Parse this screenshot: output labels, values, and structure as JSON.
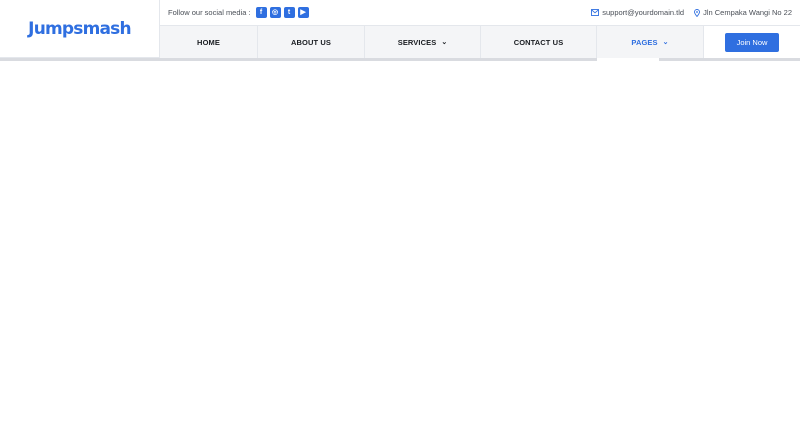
{
  "brand": {
    "logo_text": "Jumpsmash"
  },
  "topbar": {
    "follow_label": "Follow our social media :",
    "socials": [
      {
        "icon": "facebook-icon",
        "glyph": "f"
      },
      {
        "icon": "instagram-icon",
        "glyph": "◎"
      },
      {
        "icon": "twitter-icon",
        "glyph": "t"
      },
      {
        "icon": "youtube-icon",
        "glyph": "▶"
      }
    ],
    "email": "support@yourdomain.tld",
    "address": "Jln Cempaka Wangi No 22"
  },
  "nav": {
    "items": [
      {
        "label": "HOME",
        "dropdown": false
      },
      {
        "label": "ABOUT US",
        "dropdown": false
      },
      {
        "label": "SERVICES",
        "dropdown": true
      },
      {
        "label": "CONTACT US",
        "dropdown": false
      },
      {
        "label": "PAGES",
        "dropdown": true,
        "active": true
      }
    ],
    "cta_label": "Join Now"
  },
  "colors": {
    "accent": "#2f6fe0",
    "logo_dot": "#f5a524",
    "nav_bg": "#f4f5f7"
  }
}
